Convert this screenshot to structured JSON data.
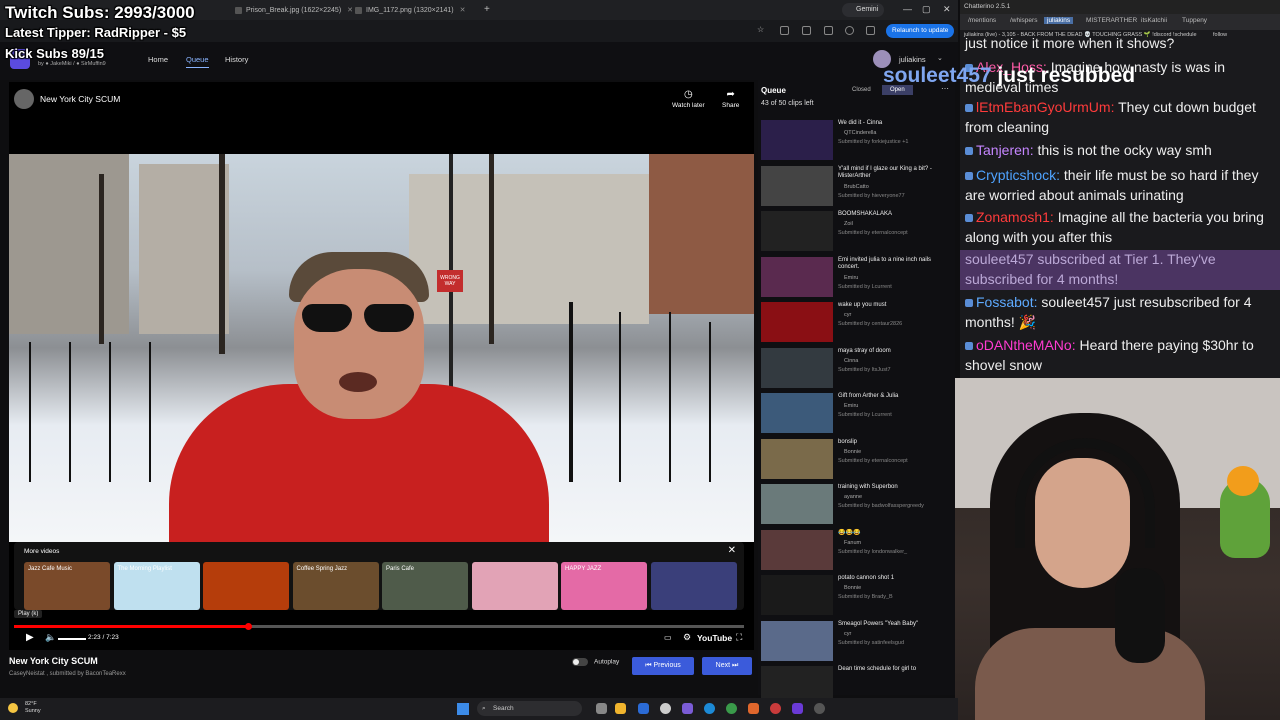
{
  "overlay": {
    "twitch_subs": "Twitch Subs: 2993/3000",
    "latest_tipper": "Latest Tipper: RadRipper - $5",
    "kick_subs": "Kick Subs 89/15",
    "resub_name": "souleet457",
    "resub_text": "just resubbed"
  },
  "browser": {
    "tabs": [
      {
        "label": "Prison_Break.jpg (1622×2245)"
      },
      {
        "label": "IMG_1172.png (1320×2141)"
      }
    ],
    "gemini_label": "Gemini",
    "relaunch_label": "Relaunch to update"
  },
  "site": {
    "credit_by": "by",
    "credit_1": "JakeMiki",
    "credit_2": "SirMuffin9",
    "nav": {
      "home": "Home",
      "queue": "Queue",
      "history": "History"
    },
    "user": "juliakins"
  },
  "player": {
    "title": "New York City SCUM",
    "watch_later": "Watch later",
    "share": "Share",
    "sign_text": "WRONG WAY",
    "more_videos_label": "More videos",
    "thumbs": [
      {
        "label": "Jazz Cafe Music",
        "color": "#7a4a2a"
      },
      {
        "label": "The Morning Playlist",
        "color": "#bfe0ef"
      },
      {
        "label": "",
        "color": "#b53d0b"
      },
      {
        "label": "Coffee Spring Jazz",
        "color": "#6b4d2d"
      },
      {
        "label": "Paris Cafe",
        "color": "#4f5b4a"
      },
      {
        "label": "",
        "color": "#e2a3b6"
      },
      {
        "label": "HAPPY JAZZ",
        "color": "#e46aa6"
      },
      {
        "label": "",
        "color": "#3a3f7a"
      }
    ],
    "tooltip": "Play (k)",
    "time": "2:23 / 7:23",
    "progress": 0.32,
    "youtube_label": "YouTube"
  },
  "below": {
    "title": "New York City SCUM",
    "submitter": "CaseyNeistat , submitted by BaconTeaRexx",
    "autoplay_label": "Autoplay",
    "previous_label": "Previous",
    "next_label": "Next"
  },
  "queue": {
    "title": "Queue",
    "closed_label": "Closed",
    "open_label": "Open",
    "count": "43 of 50 clips left",
    "items": [
      {
        "title": "We did it - Cinna",
        "by": "QTCinderella",
        "sub": "Submitted by forkiejustice +1",
        "color": "#2b1f4a"
      },
      {
        "title": "Y'all mind if I glaze our King a bit? - MisterArther",
        "by": "BrubCatto",
        "sub": "Submitted by hieveryone77",
        "color": "#444"
      },
      {
        "title": "BOOMSHAKALAKA",
        "by": "Zoil",
        "sub": "Submitted by eternalconcept",
        "color": "#222"
      },
      {
        "title": "Emi invited julia to a nine inch nails concert.",
        "by": "Emiru",
        "sub": "Submitted by Lcurrent",
        "color": "#5a2a4f"
      },
      {
        "title": "wake up you must",
        "by": "cyr",
        "sub": "Submitted by centaur2826",
        "color": "#8a0f14"
      },
      {
        "title": "maya stray of doom",
        "by": "Cinna",
        "sub": "Submitted by ItsJust7",
        "color": "#333a40"
      },
      {
        "title": "Gift from Arther & Julia",
        "by": "Emiru",
        "sub": "Submitted by Lcurrent",
        "color": "#3c5a7a"
      },
      {
        "title": "bonslip",
        "by": "Bonnie",
        "sub": "Submitted by eternalconcept",
        "color": "#7a6a4a"
      },
      {
        "title": "training with Superbon",
        "by": "ayanne",
        "sub": "Submitted by badwolfasspergreedy",
        "color": "#6a7a7a"
      },
      {
        "title": "😂😂😂",
        "by": "Fanum",
        "sub": "Submitted by londonwalker_",
        "color": "#5a3a3a"
      },
      {
        "title": "potato cannon shot 1",
        "by": "Bonnie",
        "sub": "Submitted by Brady_B",
        "color": "#1a1a1a"
      },
      {
        "title": "Smeagol Powers \"Yeah Baby\"",
        "by": "cyr",
        "sub": "Submitted by satinfeelsgud",
        "color": "#5a6a8a"
      },
      {
        "title": "Dean time schedule for girl to",
        "by": "",
        "sub": "",
        "color": "#222"
      }
    ]
  },
  "chat": {
    "titlebar": "Chatterino 2.5.1",
    "tabs": [
      "/mentions",
      "/whispers",
      "juliakins",
      "MISTERARTHER",
      "itsKatchii",
      "Tuppeny"
    ],
    "status": "juliakins (live) - 3,105 - BACK FROM THE DEAD 💀 TOUCHING GRASS 🌱 !discord !schedule",
    "follow_label": "follow",
    "messages": [
      {
        "user": "",
        "color": "#fff",
        "text": "just notice it more when it shows?"
      },
      {
        "user": "Alex_Hoss:",
        "color": "#ff5ca8",
        "text": "Imagine how nasty is was in medieval times"
      },
      {
        "user": "lEtmEbanGyoUrmUm:",
        "color": "#ff3b3b",
        "text": "They cut down budget from cleaning"
      },
      {
        "user": "Tanjeren:",
        "color": "#c586ff",
        "text": "this is not the ocky way smh"
      },
      {
        "user": "Crypticshock:",
        "color": "#4fa3ff",
        "text": "their life must be so hard if they are worried about animals urinating"
      },
      {
        "user": "Zonamosh1:",
        "color": "#ff3b3b",
        "text": "Imagine all the bacteria you bring along with you after this"
      },
      {
        "user": "Fossabot:",
        "color": "#5eaaff",
        "text": "souleet457 just resubscribed for 4 months! 🎉"
      },
      {
        "user": "oDANtheMANo:",
        "color": "#ff3bd1",
        "text": "Heard there paying $30hr to shovel snow"
      }
    ],
    "sub_notice": "souleet457 subscribed at Tier 1. They've subscribed for 4 months!"
  },
  "taskbar": {
    "temp": "82°F",
    "condition": "Sunny",
    "search": "Search"
  }
}
